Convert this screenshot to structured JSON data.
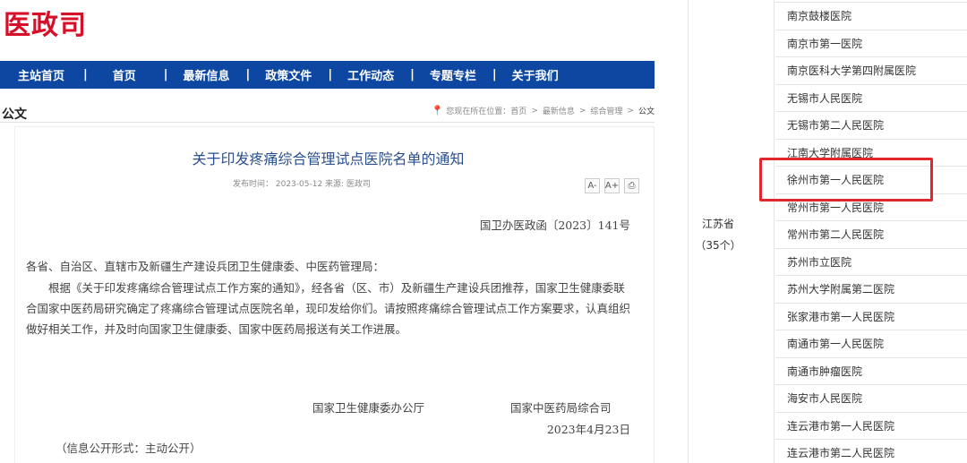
{
  "site": {
    "logo": "医政司"
  },
  "nav": {
    "items": [
      "主站首页",
      "首页",
      "最新信息",
      "政策文件",
      "工作动态",
      "专题专栏",
      "关于我们"
    ],
    "separator": "|"
  },
  "section": {
    "title": "公文"
  },
  "breadcrumb": {
    "prefix": "您现在所在位置：",
    "items": [
      "首页",
      "最新信息",
      "综合管理",
      "公文"
    ],
    "separator": ">"
  },
  "article": {
    "title": "关于印发疼痛综合管理试点医院名单的通知",
    "meta": "发布时间： 2023-05-12   来源: 医政司",
    "tools": {
      "font_smaller": "A-",
      "font_larger": "A+",
      "print": "⎙"
    },
    "doc_number": "国卫办医政函〔2023〕141号",
    "salutation": "各省、自治区、直辖市及新疆生产建设兵团卫生健康委、中医药管理局：",
    "body": "根据《关于印发疼痛综合管理试点工作方案的通知》，经各省（区、市）及新疆生产建设兵团推荐，国家卫生健康委联合国家中医药局研究确定了疼痛综合管理试点医院名单，现印发给你们。请按照疼痛综合管理试点工作方案要求，认真组织做好相关工作，并及时向国家卫生健康委、国家中医药局报送有关工作进展。",
    "signatory_1": "国家卫生健康委办公厅",
    "signatory_2": "国家中医药局综合司",
    "date": "2023年4月23日",
    "publish_form": "（信息公开形式：主动公开）"
  },
  "table": {
    "province": "江苏省",
    "count": "（35个）",
    "hospitals": [
      "南京鼓楼医院",
      "南京市第一医院",
      "南京医科大学第四附属医院",
      "无锡市人民医院",
      "无锡市第二人民医院",
      "江南大学附属医院",
      "徐州市第一人民医院",
      "常州市第一人民医院",
      "常州市第二人民医院",
      "苏州市立医院",
      "苏州大学附属第二医院",
      "张家港市第一人民医院",
      "南通市第一人民医院",
      "南通市肿瘤医院",
      "海安市人民医院",
      "连云港市第一人民医院",
      "连云港市第二人民医院"
    ],
    "highlighted": "徐州市第一人民医院"
  },
  "colors": {
    "nav_bg": "#0d47a1",
    "logo": "#d7102a",
    "title": "#2a4f8f",
    "highlight": "#e0282c"
  }
}
